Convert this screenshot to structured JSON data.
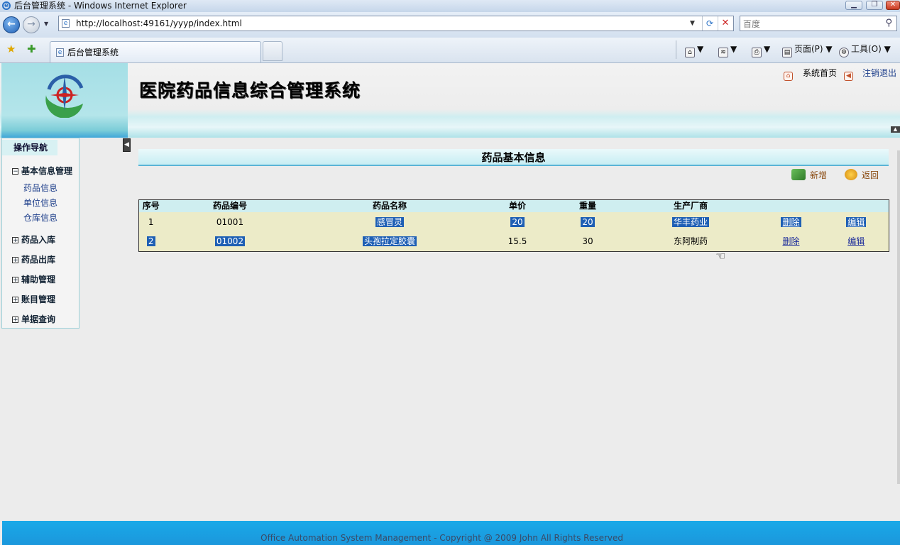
{
  "window": {
    "title": "后台管理系统 - Windows Internet Explorer",
    "controls": {
      "minimize": "▁",
      "maximize": "❐",
      "close": "✕"
    }
  },
  "browser": {
    "url": "http://localhost:49161/yyyp/index.html",
    "search_placeholder": "百度",
    "tab_title": "后台管理系统",
    "commands": {
      "page": "页面(P)",
      "tools": "工具(O)"
    },
    "icons": [
      "back-icon",
      "forward-icon",
      "refresh-icon",
      "stop-icon",
      "search-icon",
      "favorites-star-icon",
      "add-favorites-icon",
      "home-icon",
      "rss-feed-icon",
      "print-icon",
      "page-icon",
      "gear-icon"
    ]
  },
  "app": {
    "title": "医院药品信息综合管理系统",
    "top_links": {
      "home": "系统首页",
      "logout": "注销退出"
    },
    "footer": "Office Automation System Management - Copyright @ 2009 John All Rights Reserved"
  },
  "nav": {
    "header": "操作导航",
    "groups": [
      {
        "label": "基本信息管理",
        "expanded": true,
        "items": [
          "药品信息",
          "单位信息",
          "仓库信息"
        ]
      },
      {
        "label": "药品入库",
        "expanded": false
      },
      {
        "label": "药品出库",
        "expanded": false
      },
      {
        "label": "辅助管理",
        "expanded": false
      },
      {
        "label": "账目管理",
        "expanded": false
      },
      {
        "label": "单据查询",
        "expanded": false
      }
    ]
  },
  "content": {
    "section_title": "药品基本信息",
    "actions": {
      "add": "新增",
      "back": "返回"
    },
    "table": {
      "columns": [
        "序号",
        "药品编号",
        "药品名称",
        "单价",
        "重量",
        "生产厂商",
        "",
        ""
      ],
      "rows": [
        {
          "index": "1",
          "code": "01001",
          "name": "感冒灵",
          "price": "20",
          "weight": "20",
          "maker": "华丰药业",
          "delete": "删除",
          "edit": "编辑"
        },
        {
          "index": "2",
          "code": "01002",
          "name": "头孢拉定胶囊",
          "price": "15.5",
          "weight": "30",
          "maker": "东阿制药",
          "delete": "删除",
          "edit": "编辑"
        }
      ]
    }
  },
  "colors": {
    "accent": "#1aa9e8",
    "header_row": "#cfeef0",
    "data_row": "#ecebc8",
    "selection": "#1e5fb4"
  }
}
